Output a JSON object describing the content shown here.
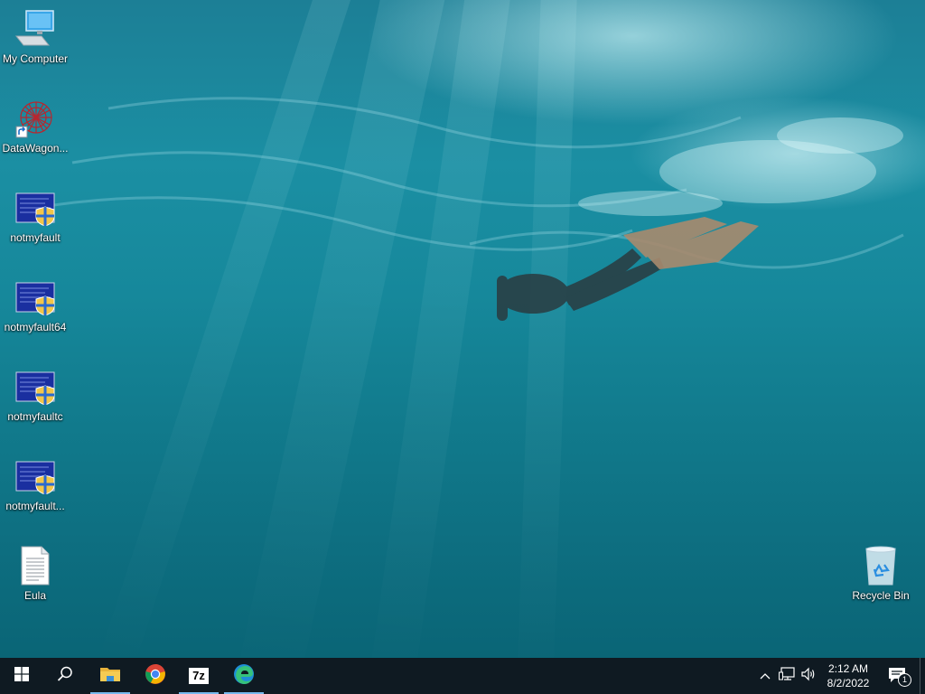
{
  "desktop": {
    "wallpaper": "underwater-freediver",
    "icons": [
      {
        "label": "My Computer",
        "icon": "computer-icon"
      },
      {
        "label": "DataWagon...",
        "icon": "datawagon-shortcut-icon"
      },
      {
        "label": "notmyfault",
        "icon": "notmyfault-icon"
      },
      {
        "label": "notmyfault64",
        "icon": "notmyfault-icon"
      },
      {
        "label": "notmyfaultc",
        "icon": "notmyfault-icon"
      },
      {
        "label": "notmyfault...",
        "icon": "notmyfault-icon"
      },
      {
        "label": "Eula",
        "icon": "text-document-icon"
      },
      {
        "label": "Recycle Bin",
        "icon": "recycle-bin-icon"
      }
    ]
  },
  "taskbar": {
    "background": "#0f1a22",
    "accent": "#76b9ed",
    "buttons": [
      {
        "name": "start-button",
        "icon": "windows-logo-icon"
      },
      {
        "name": "search-button",
        "icon": "search-icon"
      },
      {
        "name": "file-explorer-button",
        "icon": "folder-icon",
        "active": true
      },
      {
        "name": "chrome-button",
        "icon": "chrome-icon"
      },
      {
        "name": "7zip-button",
        "icon": "7zip-icon",
        "active": true
      },
      {
        "name": "edge-button",
        "icon": "edge-icon",
        "active": true
      }
    ],
    "seven_zip_label": "7z",
    "clock": {
      "time": "2:12 AM",
      "date": "8/2/2022"
    },
    "notifications": {
      "count": "1"
    }
  }
}
